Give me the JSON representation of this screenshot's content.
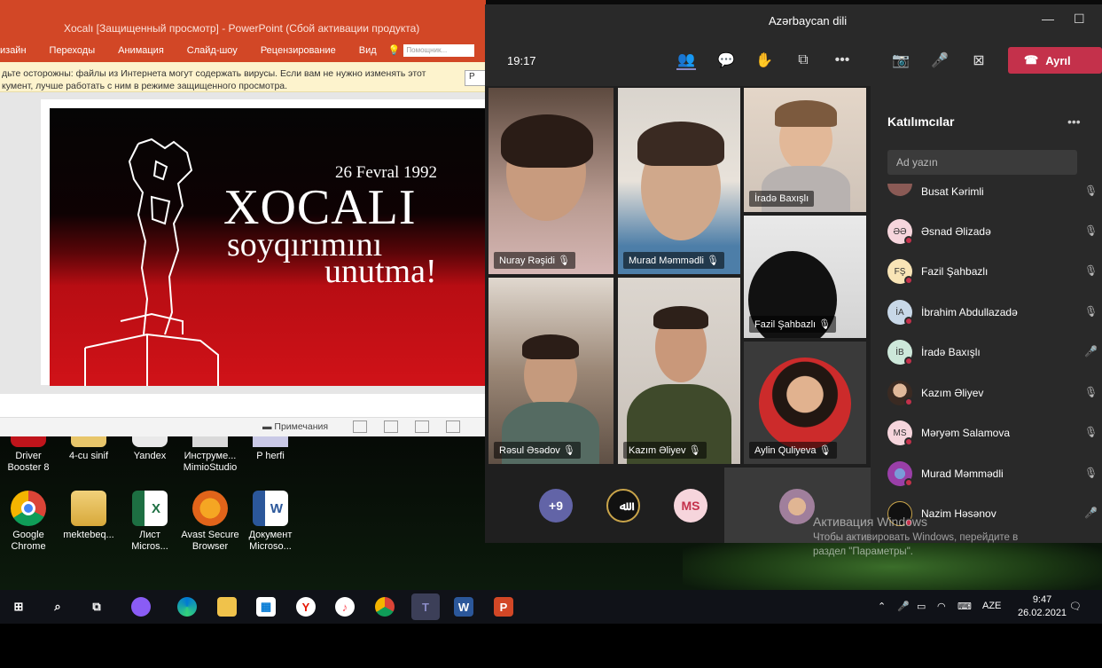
{
  "powerpoint": {
    "title": "Xocalı [Защищенный просмотр] - PowerPoint (Сбой активации продукта)",
    "tabs": [
      "изайн",
      "Переходы",
      "Анимация",
      "Слайд-шоу",
      "Рецензирование",
      "Вид"
    ],
    "help_placeholder": "Помощник...",
    "warning_line1": "дьте осторожны: файлы из Интернета могут содержать вирусы. Если вам не нужно изменять этот",
    "warning_line2": "кумент, лучше работать с ним в режиме защищенного просмотра.",
    "warning_button": "Р",
    "slide": {
      "date": "26 Fevral 1992",
      "headline": "XOCALI",
      "line2": "soyqırımını",
      "line3": "unutma!"
    },
    "notes_label": "Примечания"
  },
  "teams": {
    "title": "Azərbaycan dili",
    "clock": "19:17",
    "leave_label": "Ayrıl",
    "tiles": [
      "Nuray Rəşidi",
      "Murad Məmmədli",
      "İradə Baxışlı",
      "Fazil Şahbazlı",
      "Rəsul Əsədov",
      "Kazım Əliyev",
      "Aylin Quliyeva"
    ],
    "overflow_count": "+9",
    "bottom_avatar_initials": "MS",
    "bottom_avatar_glyph": "ﷲ",
    "panel": {
      "heading": "Katılımcılar",
      "search_placeholder": "Ad yazın",
      "participants": [
        {
          "name": "Busat Kərimli",
          "initials": "",
          "mic": "muted"
        },
        {
          "name": "Əsnad Əlizadə",
          "initials": "ƏƏ",
          "mic": "muted"
        },
        {
          "name": "Fazil Şahbazlı",
          "initials": "FŞ",
          "mic": "muted"
        },
        {
          "name": "İbrahim Abdullazadə",
          "initials": "İA",
          "mic": "muted"
        },
        {
          "name": "İradə Baxışlı",
          "initials": "İB",
          "mic": "on"
        },
        {
          "name": "Kazım Əliyev",
          "initials": "",
          "mic": "muted"
        },
        {
          "name": "Məryəm Salamova",
          "initials": "MS",
          "mic": "muted"
        },
        {
          "name": "Murad Məmmədli",
          "initials": "",
          "mic": "muted"
        },
        {
          "name": "Nazim Həsənov",
          "initials": "",
          "mic": "on"
        }
      ]
    }
  },
  "activation": {
    "title": "Активация Windows",
    "line1": "Чтобы активировать Windows, перейдите в",
    "line2": "раздел \"Параметры\"."
  },
  "desktop_icons": [
    {
      "label1": "Driver",
      "label2": "Booster 8",
      "icon": "driver-booster-icon"
    },
    {
      "label1": "4-cu sinif",
      "label2": "",
      "icon": "folder-icon"
    },
    {
      "label1": "Yandex",
      "label2": "",
      "icon": "yandex-icon"
    },
    {
      "label1": "Инструме...",
      "label2": "MimioStudio",
      "icon": "mimio-icon"
    },
    {
      "label1": "P herfi",
      "label2": "",
      "icon": "file-icon"
    },
    {
      "label1": "Google",
      "label2": "Chrome",
      "icon": "chrome-icon"
    },
    {
      "label1": "mektebeq...",
      "label2": "",
      "icon": "folder-icon"
    },
    {
      "label1": "Лист",
      "label2": "Micros...",
      "icon": "excel-icon"
    },
    {
      "label1": "Avast Secure",
      "label2": "Browser",
      "icon": "avast-icon"
    },
    {
      "label1": "Документ",
      "label2": "Microso...",
      "icon": "word-icon"
    }
  ],
  "taskbar": {
    "language": "AZE",
    "time": "9:47",
    "date": "26.02.2021"
  },
  "colors": {
    "ppt_accent": "#d24726",
    "teams_leave": "#c4314b",
    "teams_bg": "#1f1f1f"
  }
}
